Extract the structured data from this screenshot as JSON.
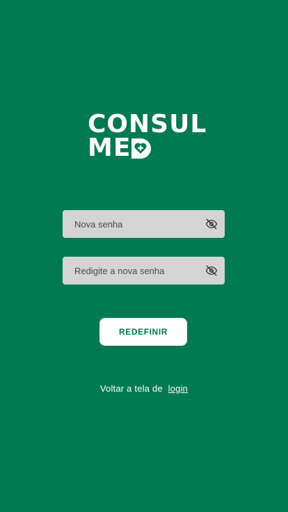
{
  "logo": {
    "line1": "CONSUL",
    "line2": "ME",
    "line2_tail_icon": "heart-plus-icon"
  },
  "form": {
    "new_password": {
      "placeholder": "Nova senha",
      "value": "",
      "toggle_icon": "eye-off-icon"
    },
    "confirm_password": {
      "placeholder": "Redigite a nova senha",
      "value": "",
      "toggle_icon": "eye-off-icon"
    },
    "submit_label": "REDEFINIR"
  },
  "footer": {
    "text": "Voltar a tela de",
    "link_label": "login"
  },
  "colors": {
    "background": "#017a52",
    "field_background": "#d4d4d4",
    "button_background": "#ffffff",
    "button_text": "#017a52"
  }
}
